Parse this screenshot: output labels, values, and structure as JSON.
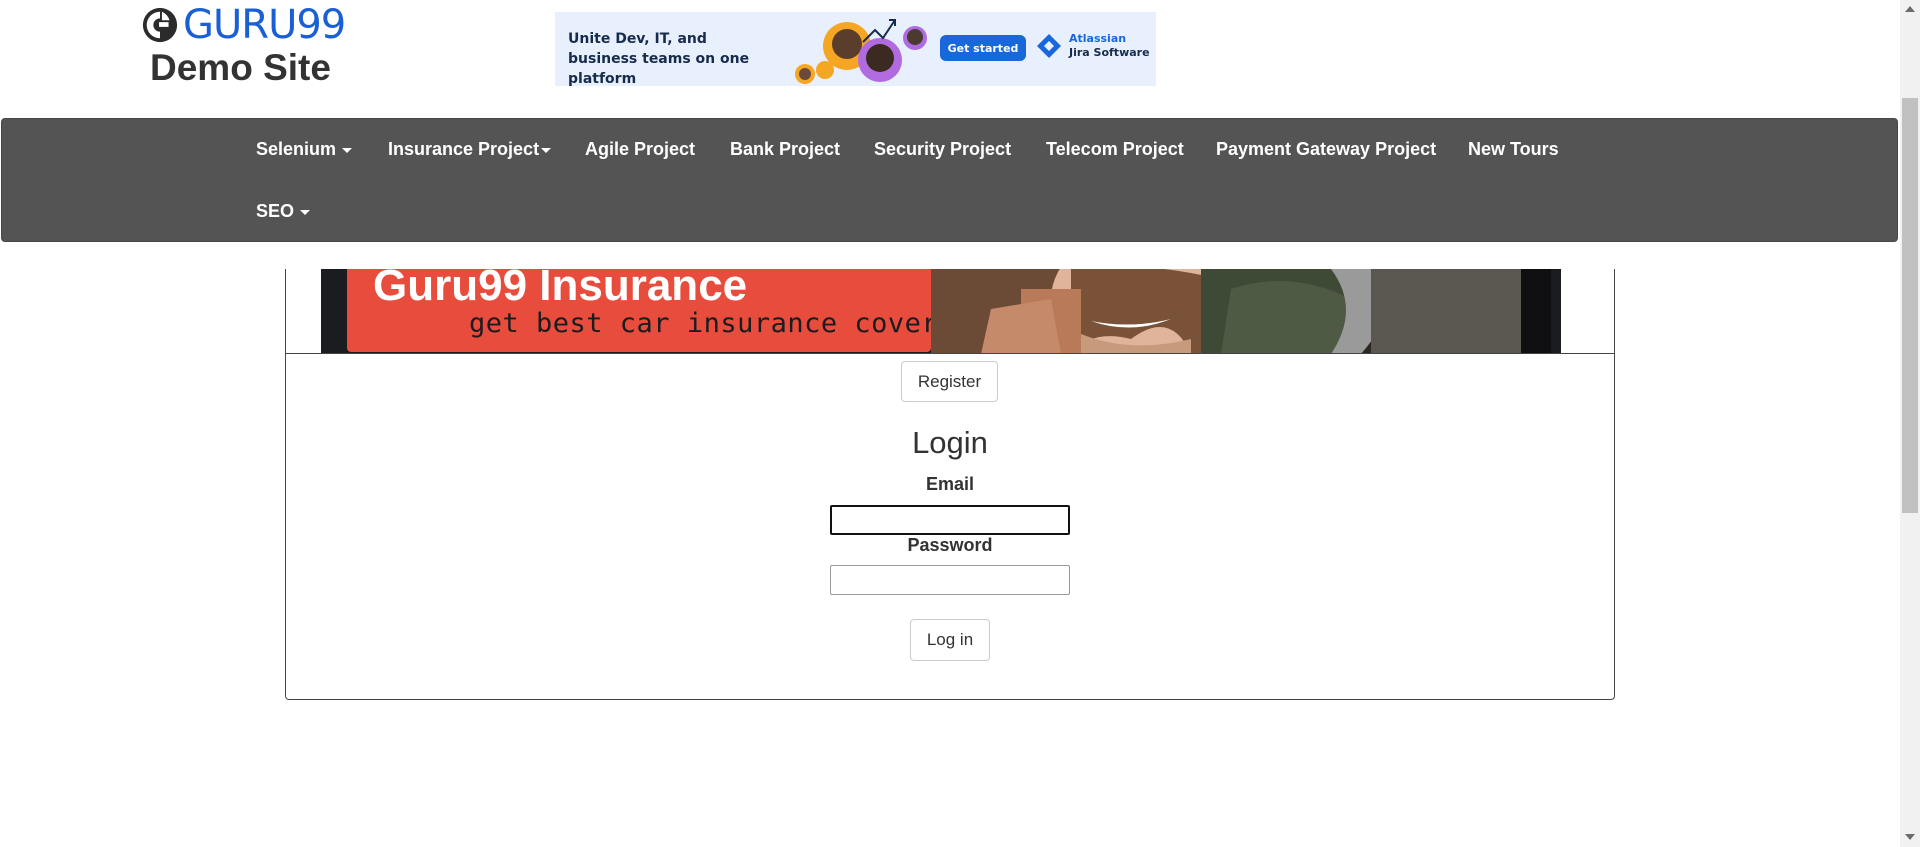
{
  "header": {
    "logo_text": "GURU99",
    "site_title": "Demo Site"
  },
  "ad": {
    "headline": "Unite Dev, IT, and business teams on one platform",
    "cta_label": "Get started",
    "brand_name": "Atlassian",
    "brand_product": "Jira Software",
    "accent_color": "#1868db"
  },
  "navbar": {
    "items": [
      {
        "label": "Selenium",
        "has_dropdown": true
      },
      {
        "label": "Insurance Project",
        "has_dropdown": true
      },
      {
        "label": "Agile Project",
        "has_dropdown": false
      },
      {
        "label": "Bank Project",
        "has_dropdown": false
      },
      {
        "label": "Security Project",
        "has_dropdown": false
      },
      {
        "label": "Telecom Project",
        "has_dropdown": false
      },
      {
        "label": "Payment Gateway Project",
        "has_dropdown": false
      },
      {
        "label": "New Tours",
        "has_dropdown": false
      },
      {
        "label": "SEO",
        "has_dropdown": true
      }
    ],
    "background_color": "#545454"
  },
  "banner": {
    "title": "Guru99 Insurance",
    "tagline": "get best car insurance coverage",
    "accent_color": "#e84c3d"
  },
  "main": {
    "register_label": "Register",
    "login_heading": "Login",
    "email_label": "Email",
    "email_value": "",
    "password_label": "Password",
    "password_value": "",
    "login_button_label": "Log in"
  }
}
